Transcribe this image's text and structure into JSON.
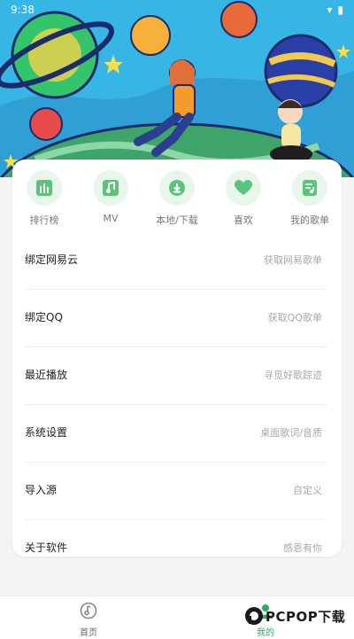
{
  "status": {
    "time": "9:38"
  },
  "quick_actions": [
    {
      "label": "排行榜",
      "icon": "chart-icon"
    },
    {
      "label": "MV",
      "icon": "music-note-icon"
    },
    {
      "label": "本地/下载",
      "icon": "download-icon"
    },
    {
      "label": "喜欢",
      "icon": "heart-icon"
    },
    {
      "label": "我的歌单",
      "icon": "playlist-icon"
    }
  ],
  "menu": [
    {
      "title": "绑定网易云",
      "hint": "获取网易歌单"
    },
    {
      "title": "绑定QQ",
      "hint": "获取QQ歌单"
    },
    {
      "title": "最近播放",
      "hint": "寻觅好歌踪迹"
    },
    {
      "title": "系统设置",
      "hint": "桌面歌词/音质"
    },
    {
      "title": "导入源",
      "hint": "自定义"
    },
    {
      "title": "关于软件",
      "hint": "感恩有你"
    }
  ],
  "nav": {
    "home_label": "首页",
    "mine_label": "我的"
  },
  "watermark": {
    "text": "PCPOP下载"
  },
  "colors": {
    "accent": "#27ae60",
    "icon_bg": "#e9f6ec",
    "icon_fg": "#5cc47a"
  }
}
